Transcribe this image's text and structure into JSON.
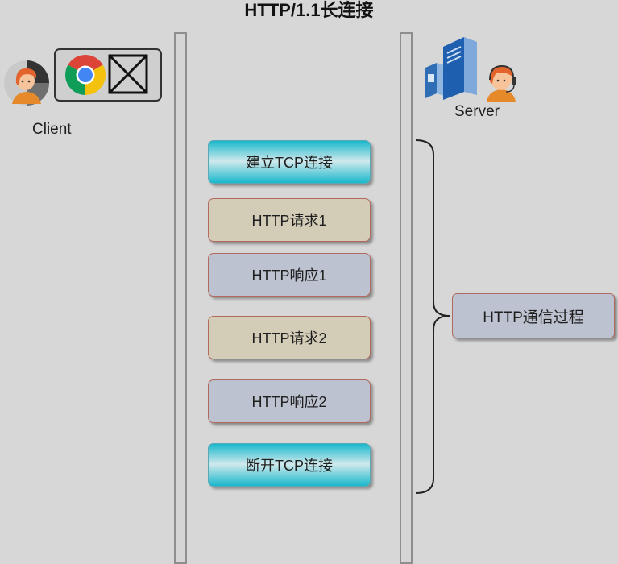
{
  "title": "HTTP/1.1长连接",
  "client": {
    "label": "Client",
    "icons": [
      "user-avatar-icon",
      "chrome-browser-icon",
      "closed-window-icon"
    ]
  },
  "server": {
    "label": "Server",
    "icons": [
      "server-icon",
      "support-agent-icon"
    ]
  },
  "steps": [
    {
      "label": "建立TCP连接",
      "kind": "tcp"
    },
    {
      "label": "HTTP请求1",
      "kind": "request"
    },
    {
      "label": "HTTP响应1",
      "kind": "response"
    },
    {
      "label": "HTTP请求2",
      "kind": "request"
    },
    {
      "label": "HTTP响应2",
      "kind": "response"
    },
    {
      "label": "断开TCP连接",
      "kind": "tcp"
    }
  ],
  "summary": {
    "label": "HTTP通信过程"
  },
  "colors": {
    "background": "#d7d7d7",
    "tcp": "#1ab8cc",
    "request": "#d3ccb7",
    "response": "#bcc2cf",
    "border_accent": "#b36a5e"
  }
}
